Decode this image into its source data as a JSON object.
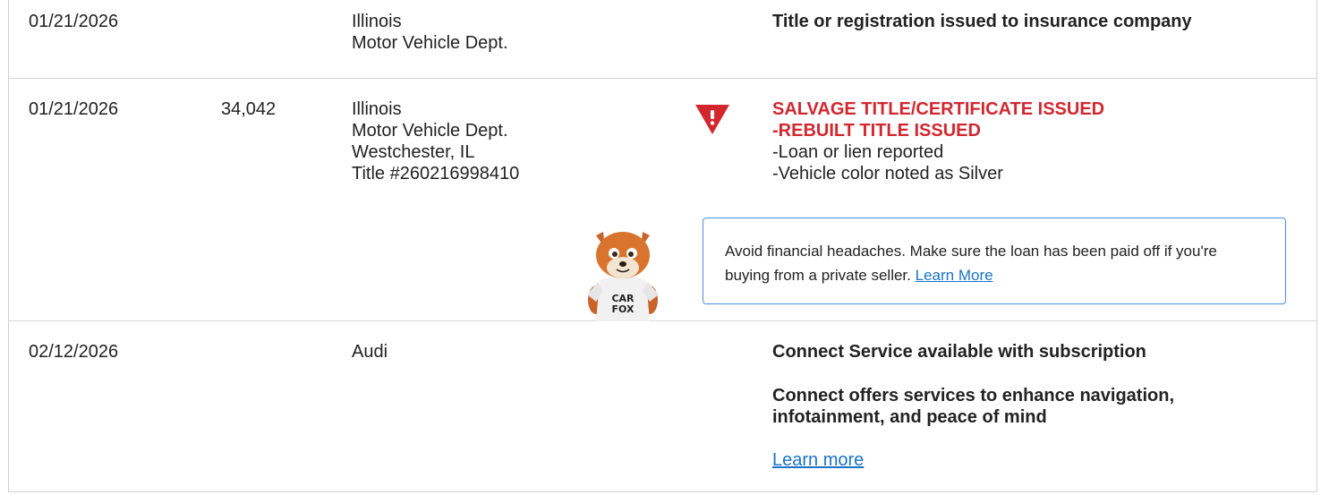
{
  "rows": [
    {
      "date": "01/21/2026",
      "mileage": "",
      "source": [
        "Illinois",
        "Motor Vehicle Dept."
      ],
      "details": [
        "Title or registration issued to insurance company"
      ]
    },
    {
      "date": "01/21/2026",
      "mileage": "34,042",
      "source": [
        "Illinois",
        "Motor Vehicle Dept.",
        "Westchester, IL",
        "Title #260216998410"
      ],
      "alert_red": [
        "SALVAGE TITLE/CERTIFICATE ISSUED",
        "-REBUILT TITLE ISSUED"
      ],
      "details": [
        "-Loan or lien reported",
        "-Vehicle color noted as Silver"
      ],
      "callout": {
        "text": "Avoid financial headaches. Make sure the loan has been paid off if you're buying from a private seller.",
        "link": "Learn More"
      },
      "mascot_shirt": [
        "CAR",
        "FOX"
      ]
    },
    {
      "date": "02/12/2026",
      "mileage": "",
      "source": [
        "Audi"
      ],
      "details": [
        "Connect Service available with subscription",
        "Connect offers services to enhance navigation, infotainment, and peace of mind"
      ],
      "link": "Learn more"
    }
  ],
  "colors": {
    "alert": "#d32730",
    "link": "#1a73c8",
    "callout_border": "#4a90d9"
  },
  "icons": {
    "warning": "warning-triangle-icon",
    "mascot": "carfox-mascot"
  }
}
